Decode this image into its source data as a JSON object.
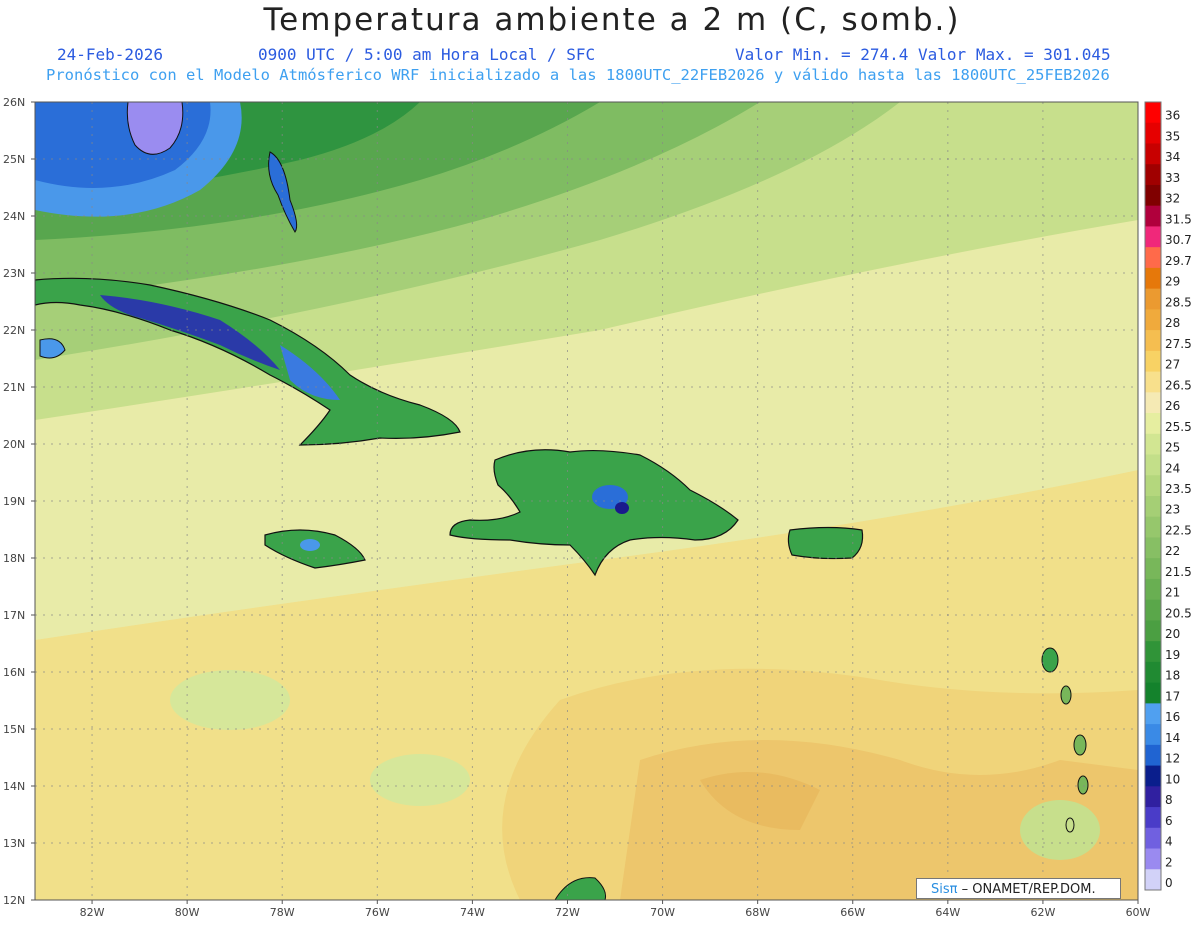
{
  "header": {
    "title": "Temperatura ambiente a 2 m (C, somb.)",
    "date": "24-Feb-2026",
    "time": "0900 UTC / 5:00 am Hora Local / SFC",
    "minmax": "Valor Min. = 274.4  Valor Max. = 301.045",
    "model_line": "Pronóstico con el Modelo Atmósferico WRF inicializado a las 1800UTC_22FEB2026 y válido hasta las  1800UTC_25FEB2026"
  },
  "map": {
    "lat_labels": [
      "26N",
      "25N",
      "24N",
      "23N",
      "22N",
      "21N",
      "20N",
      "19N",
      "18N",
      "17N",
      "16N",
      "15N",
      "14N",
      "13N",
      "12N"
    ],
    "lon_labels": [
      "82W",
      "80W",
      "78W",
      "76W",
      "74W",
      "72W",
      "70W",
      "68W",
      "66W",
      "64W",
      "62W",
      "60W"
    ],
    "lat_range": [
      12,
      26
    ],
    "lon_range": [
      -83.2,
      -60
    ],
    "grid": true
  },
  "colorbar": {
    "labels": [
      "36",
      "35",
      "34",
      "33",
      "32",
      "31.5",
      "30.7",
      "29.7",
      "29",
      "28.5",
      "28",
      "27.5",
      "27",
      "26.5",
      "26",
      "25.5",
      "25",
      "24",
      "23.5",
      "23",
      "22.5",
      "22",
      "21.5",
      "21",
      "20.5",
      "20",
      "19",
      "18",
      "17",
      "16",
      "14",
      "12",
      "10",
      "8",
      "6",
      "4",
      "2",
      "0"
    ],
    "colors": [
      "#ff0000",
      "#e60000",
      "#c80000",
      "#a00000",
      "#800000",
      "#b0003c",
      "#f0287a",
      "#ff6a4a",
      "#e6780a",
      "#eb9a30",
      "#f0aa3c",
      "#f5be50",
      "#f8d264",
      "#f8e08c",
      "#f5eab4",
      "#e6eea0",
      "#d2e692",
      "#c3df89",
      "#b4d77d",
      "#a5cf75",
      "#96c76c",
      "#87bf64",
      "#78b75a",
      "#69af52",
      "#5aa74a",
      "#4b9f42",
      "#309438",
      "#208a32",
      "#14822c",
      "#50a0f0",
      "#3a8ae6",
      "#2064d2",
      "#0a1e8c",
      "#3020a0",
      "#4a3cc8",
      "#7060e0",
      "#9a8af0",
      "#d2d2f8"
    ]
  },
  "credit": {
    "brand": "Sisπ",
    "org": " – ONAMET/REP.DOM."
  }
}
